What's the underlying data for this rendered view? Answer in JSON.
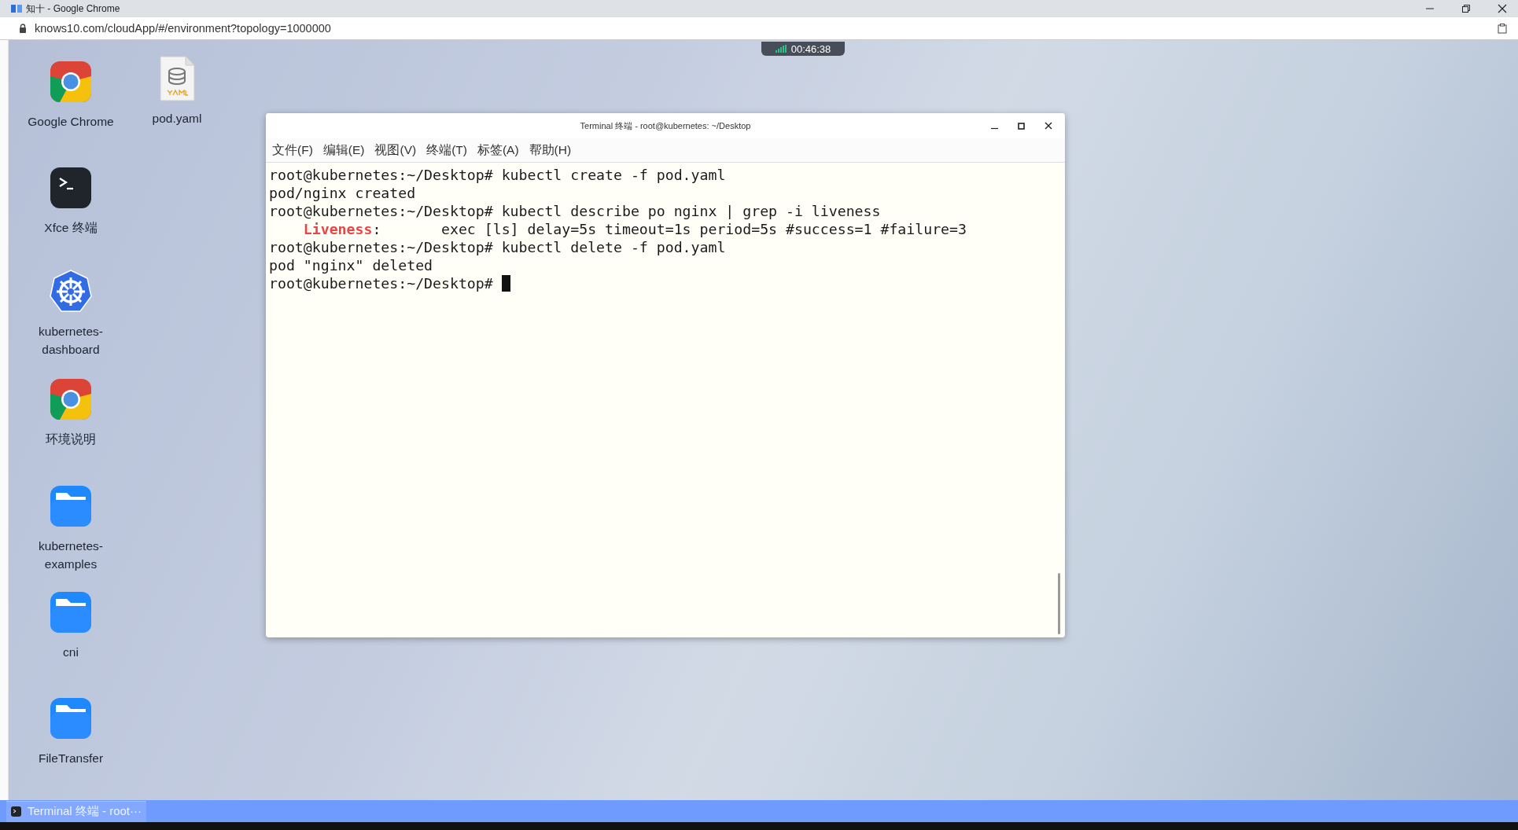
{
  "browser": {
    "title": "知十 - Google Chrome",
    "url": "knows10.com/cloudApp/#/environment?topology=1000000"
  },
  "session_timer": "00:46:38",
  "desktop_icons": [
    {
      "label": "Google Chrome",
      "kind": "chrome"
    },
    {
      "label": "pod.yaml",
      "kind": "yaml"
    },
    {
      "label": "Xfce 终端",
      "kind": "terminal"
    },
    {
      "label": "kubernetes-dashboard",
      "kind": "kubernetes"
    },
    {
      "label": "环境说明",
      "kind": "chrome"
    },
    {
      "label": "kubernetes-examples",
      "kind": "folder"
    },
    {
      "label": "cni",
      "kind": "folder"
    },
    {
      "label": "FileTransfer",
      "kind": "folder"
    }
  ],
  "terminal": {
    "title": "Terminal 终端 - root@kubernetes: ~/Desktop",
    "menu": [
      "文件(F)",
      "编辑(E)",
      "视图(V)",
      "终端(T)",
      "标签(A)",
      "帮助(H)"
    ],
    "lines": [
      [
        {
          "text": "root@kubernetes:~/Desktop# kubectl create -f pod.yaml",
          "kind": "plain"
        }
      ],
      [
        {
          "text": "pod/nginx created",
          "kind": "plain"
        }
      ],
      [
        {
          "text": "root@kubernetes:~/Desktop# kubectl describe po nginx | grep -i liveness",
          "kind": "plain"
        }
      ],
      [
        {
          "text": "Liveness",
          "kind": "match"
        },
        {
          "text": ":       exec [ls] delay=5s timeout=1s period=5s #success=1 #failure=3",
          "kind": "plain"
        }
      ],
      [
        {
          "text": "root@kubernetes:~/Desktop# kubectl delete -f pod.yaml",
          "kind": "plain"
        }
      ],
      [
        {
          "text": "pod \"nginx\" deleted",
          "kind": "plain"
        }
      ],
      [
        {
          "text": "root@kubernetes:~/Desktop# ",
          "kind": "plain"
        }
      ]
    ],
    "cursor": true
  },
  "taskbar": {
    "items": [
      {
        "label": "Terminal 终端 - root···",
        "selected": true
      }
    ]
  }
}
